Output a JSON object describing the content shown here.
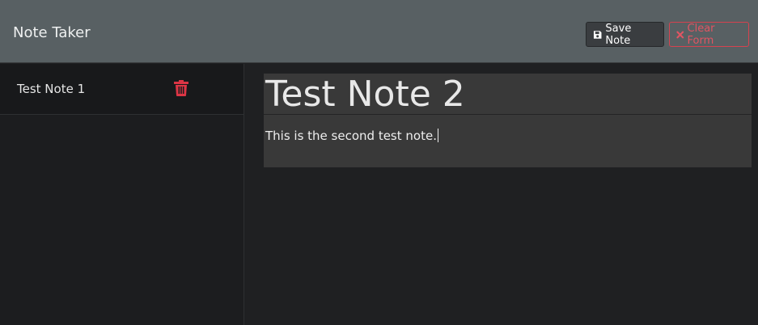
{
  "header": {
    "brand": "Note Taker",
    "save_label": "Save Note",
    "clear_label": "Clear Form"
  },
  "sidebar": {
    "notes": [
      {
        "title": "Test Note 1"
      }
    ]
  },
  "editor": {
    "title_value": "Test Note 2",
    "body_value": "This is the second test note."
  },
  "colors": {
    "navbar": "#586063",
    "danger": "#dc3545",
    "editor_bg": "#393939",
    "page_bg": "#1f2022"
  }
}
